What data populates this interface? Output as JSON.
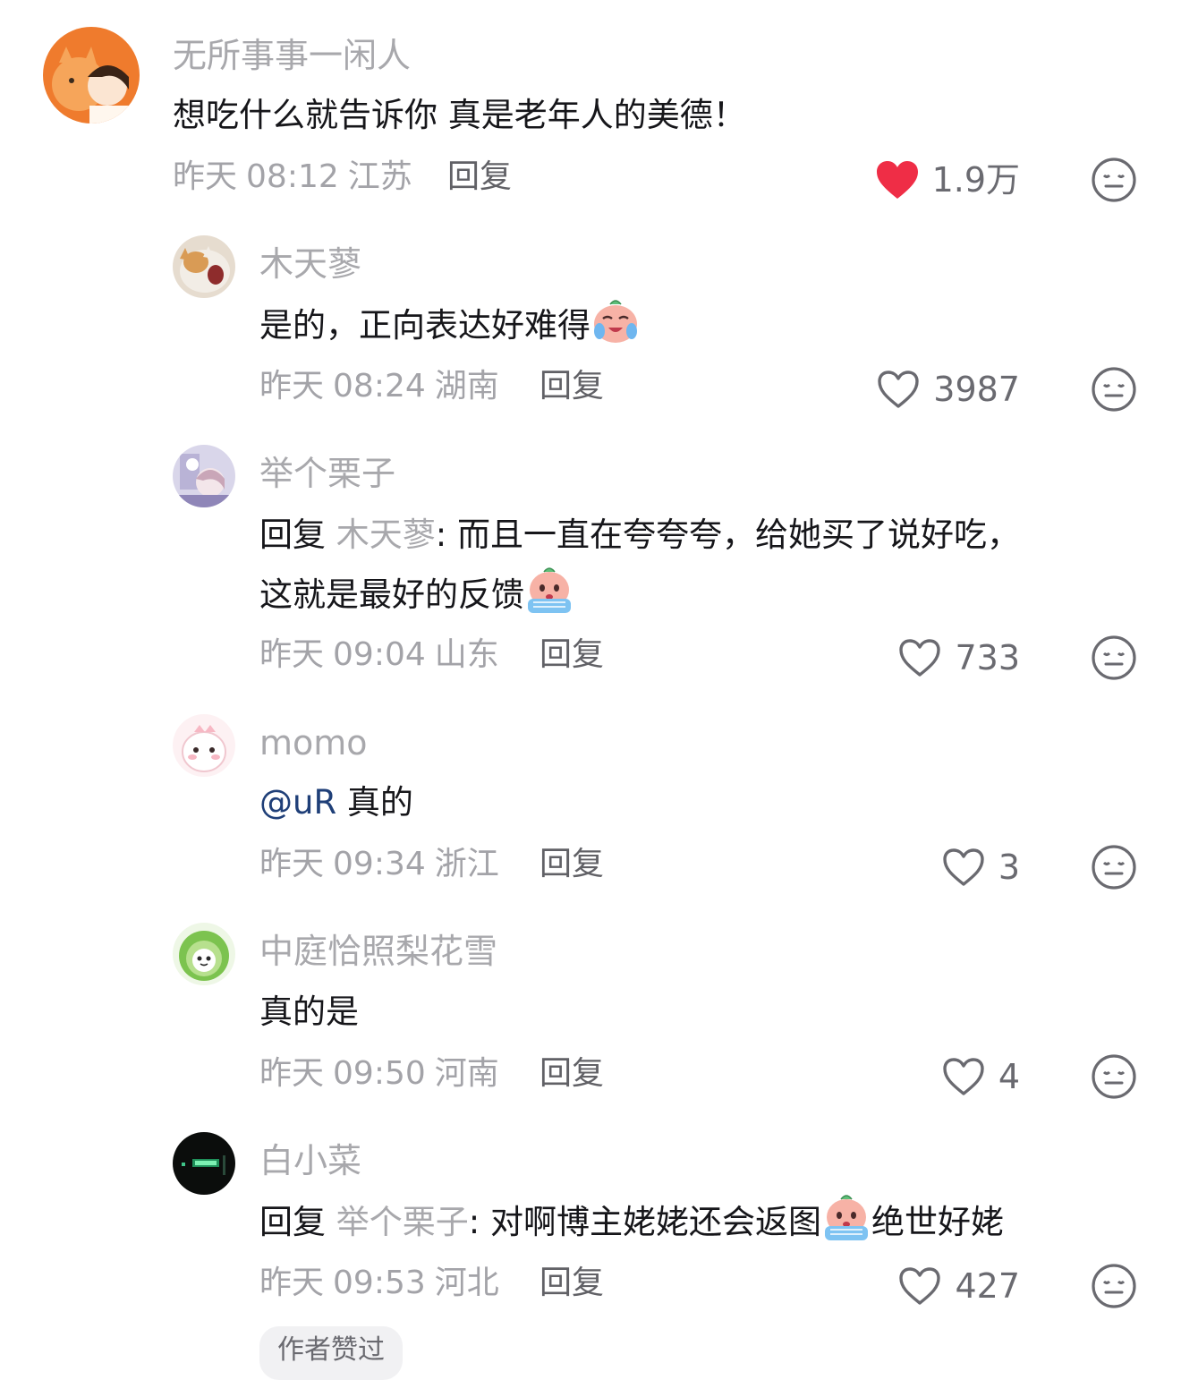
{
  "colors": {
    "username": "#a8a8ac",
    "text": "#16161a",
    "meta": "#a3a3a8",
    "reply_button": "#616166",
    "like_active": "#ef2d46",
    "mention": "#1f3f78"
  },
  "reply_label": "回复",
  "comments": [
    {
      "username": "无所事事一闲人",
      "text": "想吃什么就告诉你 真是老年人的美德！",
      "day": "昨天",
      "time": "08:12",
      "location": "江苏",
      "likes": "1.9万",
      "liked": true,
      "avatar": "cat-and-girl-avatar"
    },
    {
      "username": "木天蓼",
      "text": "是的，正向表达好难得",
      "emoji": "crying-laugh-emoji",
      "day": "昨天",
      "time": "08:24",
      "location": "湖南",
      "likes": "3987",
      "liked": false,
      "avatar": "yawning-cat-avatar"
    },
    {
      "username": "举个栗子",
      "reply_word": "回复",
      "reply_to": "木天蓼",
      "text_line1": ": 而且一直在夸夸夸，给她买了说好吃，",
      "text_line2": "这就是最好的反馈",
      "emoji": "crying-tears-emoji",
      "day": "昨天",
      "time": "09:04",
      "location": "山东",
      "likes": "733",
      "liked": false,
      "avatar": "anime-girl-avatar"
    },
    {
      "username": "momo",
      "mention": "@uR",
      "text": " 真的",
      "day": "昨天",
      "time": "09:34",
      "location": "浙江",
      "likes": "3",
      "liked": false,
      "avatar": "pink-dino-avatar"
    },
    {
      "username": "中庭恰照梨花雪",
      "text": "真的是",
      "day": "昨天",
      "time": "09:50",
      "location": "河南",
      "likes": "4",
      "liked": false,
      "avatar": "cabbage-avatar"
    },
    {
      "username": "白小菜",
      "reply_word": "回复",
      "reply_to": "举个栗子",
      "text_before_emoji": ": 对啊博主姥姥还会返图",
      "text_after_emoji": "绝世好姥",
      "emoji": "crying-tears-emoji",
      "day": "昨天",
      "time": "09:53",
      "location": "河北",
      "likes": "427",
      "liked": false,
      "badge": "作者赞过",
      "avatar": "dark-neon-avatar"
    }
  ]
}
